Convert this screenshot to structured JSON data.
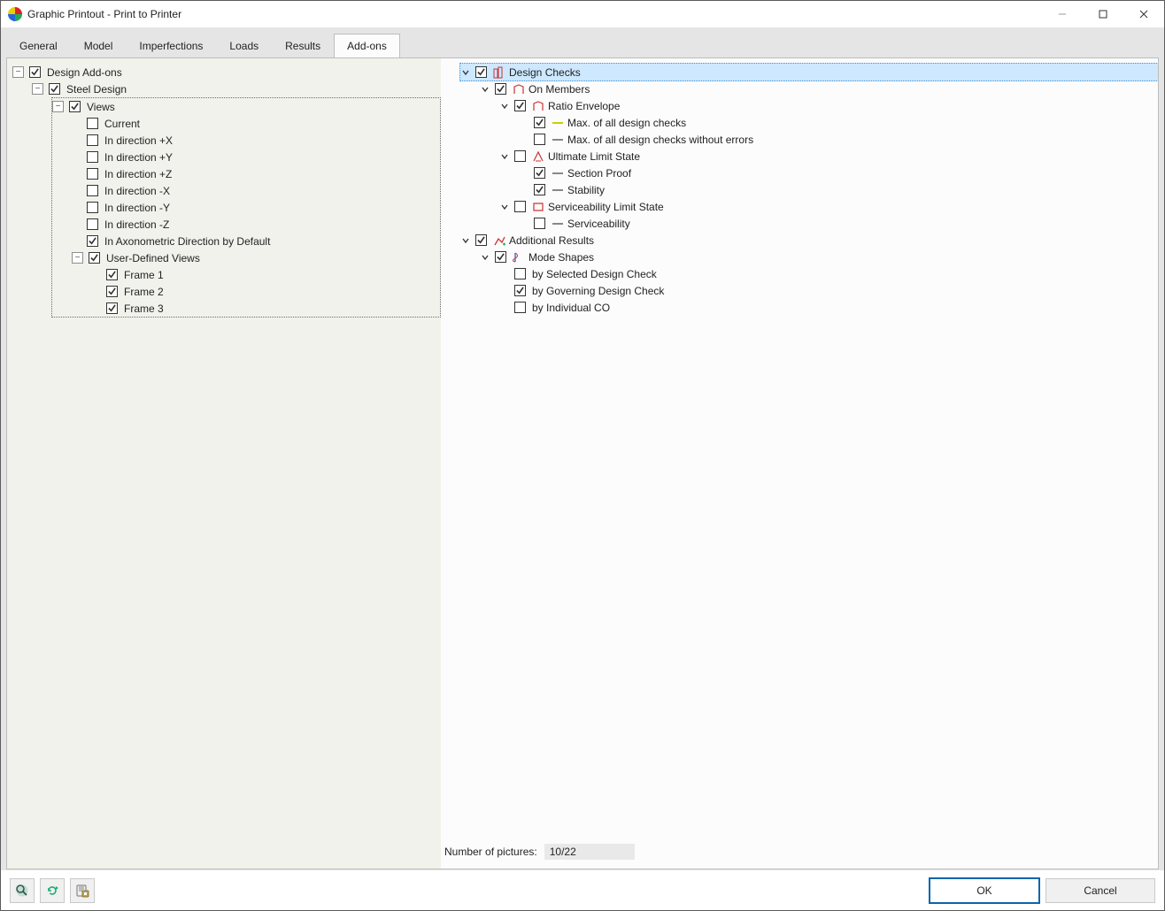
{
  "window": {
    "title": "Graphic Printout - Print to Printer"
  },
  "tabs": [
    "General",
    "Model",
    "Imperfections",
    "Loads",
    "Results",
    "Add-ons"
  ],
  "left": {
    "design_addons": "Design Add-ons",
    "steel_design": "Steel Design",
    "views": "Views",
    "view_items": [
      "Current",
      "In direction +X",
      "In direction +Y",
      "In direction +Z",
      "In direction -X",
      "In direction -Y",
      "In direction -Z",
      "In Axonometric Direction by Default"
    ],
    "user_views": "User-Defined Views",
    "frames": [
      "Frame 1",
      "Frame 2",
      "Frame 3"
    ]
  },
  "right": {
    "design_checks": "Design Checks",
    "on_members": "On Members",
    "ratio_envelope": "Ratio Envelope",
    "ratio_items": [
      "Max. of all design checks",
      "Max. of all design checks without errors"
    ],
    "uls": "Ultimate Limit State",
    "uls_items": [
      "Section Proof",
      "Stability"
    ],
    "sls": "Serviceability Limit State",
    "sls_items": [
      "Serviceability"
    ],
    "additional_results": "Additional Results",
    "mode_shapes": "Mode Shapes",
    "mode_items": [
      "by Selected Design Check",
      "by Governing Design Check",
      "by Individual CO"
    ]
  },
  "stats": {
    "label": "Number of pictures:",
    "value": "10/22"
  },
  "buttons": {
    "ok": "OK",
    "cancel": "Cancel"
  }
}
